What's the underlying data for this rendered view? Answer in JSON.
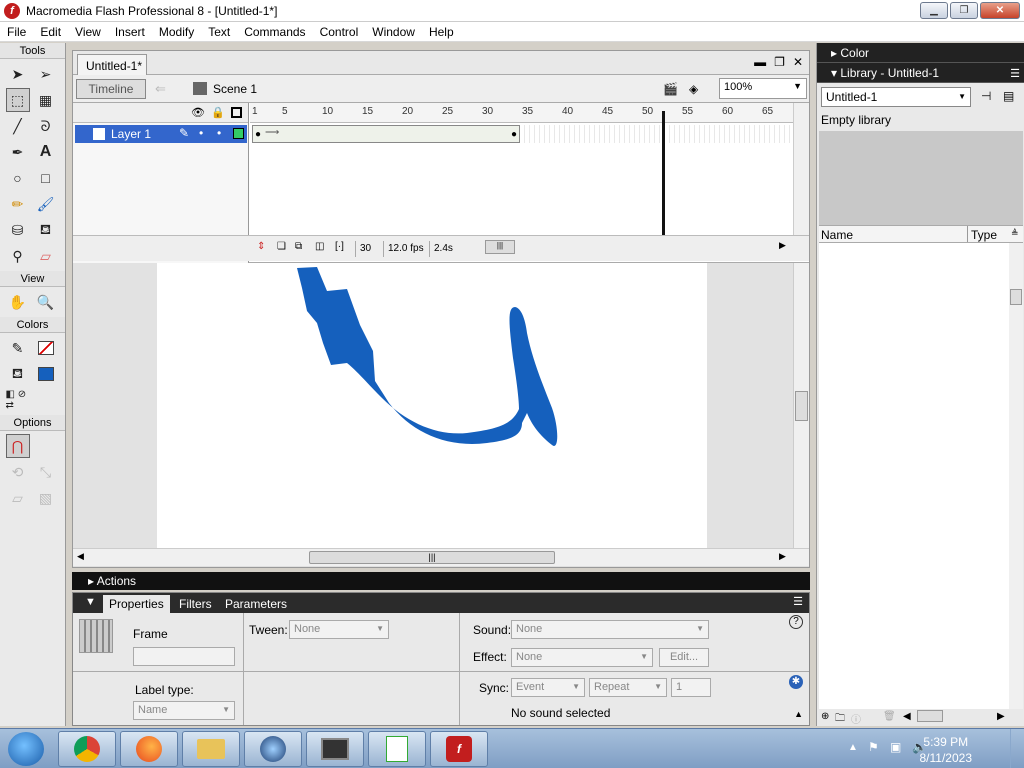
{
  "window": {
    "title": "Macromedia Flash Professional 8 - [Untitled-1*]"
  },
  "menu": [
    "File",
    "Edit",
    "View",
    "Insert",
    "Modify",
    "Text",
    "Commands",
    "Control",
    "Window",
    "Help"
  ],
  "tools": {
    "tools_label": "Tools",
    "view_label": "View",
    "colors_label": "Colors",
    "options_label": "Options"
  },
  "document": {
    "tab": "Untitled-1*",
    "timeline_button": "Timeline",
    "scene": "Scene 1",
    "zoom": "100%"
  },
  "timeline": {
    "layer_name": "Layer 1",
    "ruler_ticks": [
      "1",
      "5",
      "10",
      "15",
      "20",
      "25",
      "30",
      "35",
      "40",
      "45",
      "50",
      "55",
      "60",
      "65"
    ],
    "current_frame": "30",
    "frame_rate": "12.0 fps",
    "elapsed": "2.4s"
  },
  "stage_drawing": {
    "stroke_color": "#1560bd"
  },
  "actions": {
    "label": "Actions"
  },
  "properties": {
    "tabs": [
      "Properties",
      "Filters",
      "Parameters"
    ],
    "frame_label": "Frame",
    "label_type_label": "Label type:",
    "label_type_value": "Name",
    "tween_label": "Tween:",
    "tween_value": "None",
    "sound_label": "Sound:",
    "sound_value": "None",
    "effect_label": "Effect:",
    "effect_value": "None",
    "edit_button": "Edit...",
    "sync_label": "Sync:",
    "sync_value": "Event",
    "repeat_value": "Repeat",
    "repeat_count": "1",
    "no_sound": "No sound selected"
  },
  "color_panel": {
    "title": "Color"
  },
  "library": {
    "title": "Library - Untitled-1",
    "selector": "Untitled-1",
    "empty_text": "Empty library",
    "col_name": "Name",
    "col_type": "Type"
  },
  "taskbar": {
    "time": "5:39 PM",
    "date": "8/11/2023"
  },
  "colors": {
    "layer_selected": "#3366cc",
    "accent_dark": "#222222"
  }
}
